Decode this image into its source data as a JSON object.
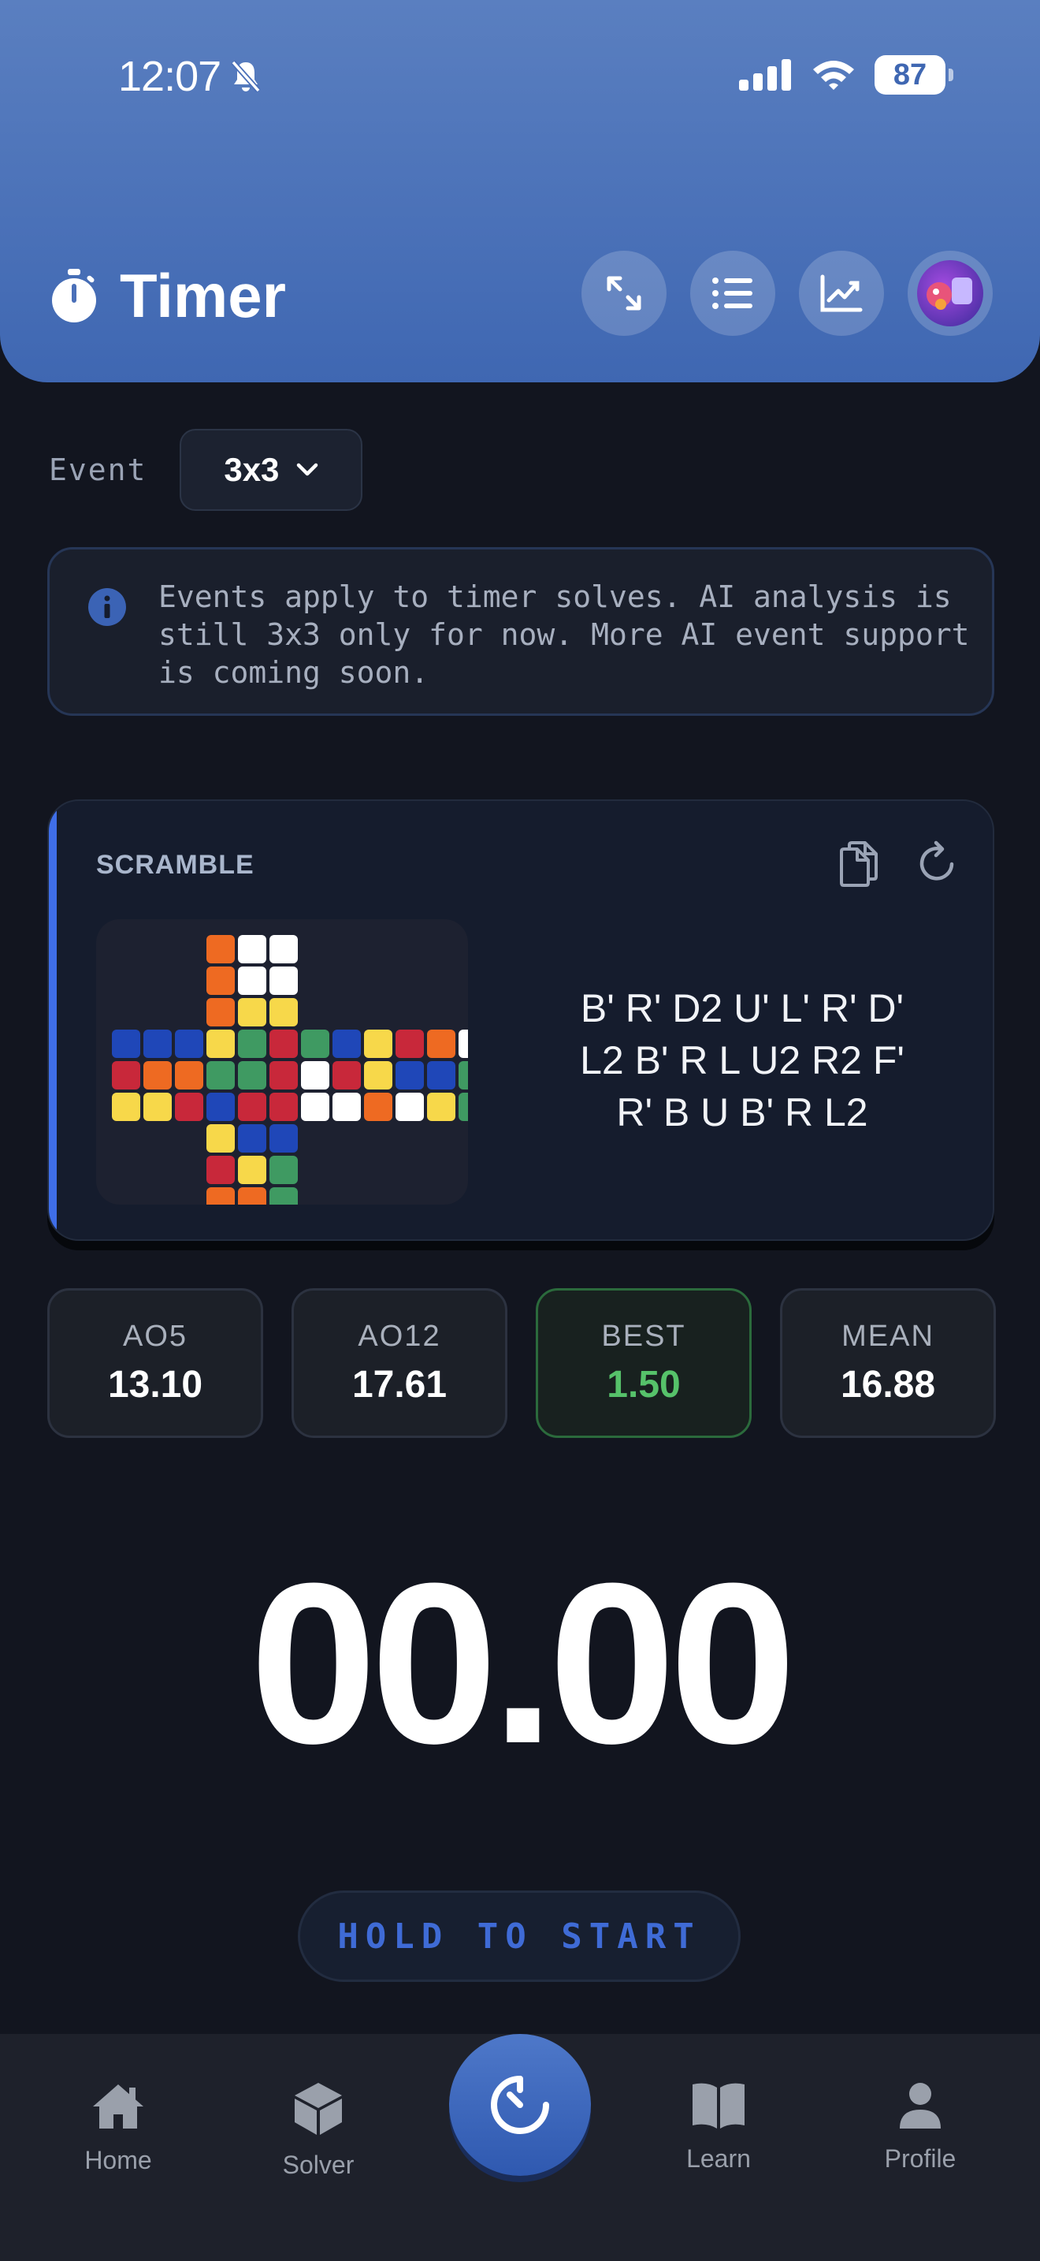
{
  "status_bar": {
    "time": "12:07",
    "battery": "87"
  },
  "header": {
    "title": "Timer"
  },
  "event": {
    "label": "Event",
    "selected": "3x3"
  },
  "info": {
    "text": "Events apply to timer solves. AI analysis is still 3x3 only for now. More AI event support is coming soon."
  },
  "scramble": {
    "label": "SCRAMBLE",
    "lines": [
      "B' R' D2 U' L' R' D'",
      "L2 B' R L U2 R2 F'",
      "R' B U B' R L2"
    ],
    "cube_net": {
      "up": [
        "O",
        "W",
        "W",
        "O",
        "W",
        "W",
        "O",
        "Y",
        "Y"
      ],
      "left": [
        "B",
        "B",
        "B",
        "R",
        "O",
        "O",
        "Y",
        "Y",
        "R"
      ],
      "front": [
        "Y",
        "G",
        "R",
        "G",
        "G",
        "R",
        "B",
        "R",
        "R"
      ],
      "right": [
        "G",
        "B",
        "Y",
        "W",
        "R",
        "Y",
        "W",
        "W",
        "O"
      ],
      "back": [
        "R",
        "O",
        "W",
        "B",
        "B",
        "G",
        "W",
        "Y",
        "G"
      ],
      "down": [
        "Y",
        "B",
        "B",
        "R",
        "Y",
        "G",
        "O",
        "O",
        "G"
      ],
      "colors": {
        "W": "#ffffff",
        "Y": "#f7d84a",
        "R": "#c8283a",
        "O": "#ee6a22",
        "B": "#1f47b8",
        "G": "#3f9a62"
      }
    }
  },
  "stats": [
    {
      "label": "AO5",
      "value": "13.10"
    },
    {
      "label": "AO12",
      "value": "17.61"
    },
    {
      "label": "BEST",
      "value": "1.50"
    },
    {
      "label": "MEAN",
      "value": "16.88"
    }
  ],
  "timer": {
    "display": "00.00",
    "hold_label": "HOLD TO START"
  },
  "tabs": [
    {
      "label": "Home"
    },
    {
      "label": "Solver"
    },
    {
      "label": "Learn"
    },
    {
      "label": "Profile"
    }
  ]
}
